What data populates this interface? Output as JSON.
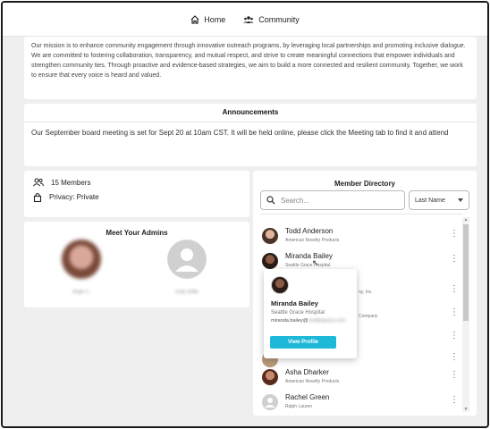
{
  "nav": {
    "home_label": "Home",
    "community_label": "Community"
  },
  "mission": {
    "text": "Our mission is to enhance community engagement through innovative outreach programs, by leveraging local partnerships and promoting inclusive dialogue. We are committed to fostering collaboration, transparency, and mutual respect, and strive to create meaningful connections that empower individuals and strengthen community ties. Through proactive and evidence-based strategies, we aim to build a more connected and resilient community. Together, we work to ensure that every voice is heard and valued."
  },
  "announcements": {
    "title": "Announcements",
    "body": "Our September board meeting is set for Sept 20 at 10am CST. It will be held online, please click the Meeting tab to find it and attend"
  },
  "group_info": {
    "members": "15 Members",
    "privacy": "Privacy: Private"
  },
  "admins": {
    "title": "Meet Your Admins",
    "items": [
      {
        "name": "Angie C."
      },
      {
        "name": "Cody Griffin"
      }
    ]
  },
  "directory": {
    "title": "Member Directory",
    "search_placeholder": "Search...",
    "sort_value": "Last Name",
    "members": [
      {
        "name": "Todd Anderson",
        "org": "American Novelty Products"
      },
      {
        "name": "Miranda Bailey",
        "org": "Seattle Grace Hospital"
      },
      {
        "name": "",
        "org": ""
      },
      {
        "name": "",
        "org": ""
      },
      {
        "name": "",
        "org": ""
      },
      {
        "name": "",
        "org": ""
      },
      {
        "name": "Asha Dharker",
        "org": "American Novelty Products"
      },
      {
        "name": "Rachel Green",
        "org": "Ralph Lauren"
      }
    ],
    "partial_orgs": [
      "ny, Inc.",
      "Company"
    ]
  },
  "popup": {
    "name": "Miranda Bailey",
    "org": "Seattle Grace Hospital",
    "email_prefix": "miranda.bailey@",
    "email_rest": "seattlegrace.com",
    "button": "View Profile"
  },
  "colors": {
    "accent": "#1eb8d8",
    "background": "#efefef"
  }
}
